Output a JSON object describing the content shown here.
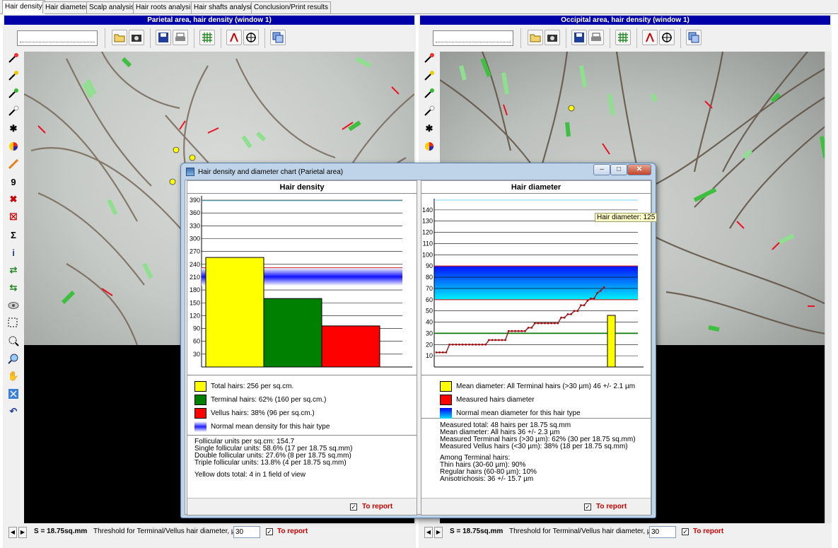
{
  "tabs": [
    {
      "label": "Hair density",
      "active": true
    },
    {
      "label": "Hair diameter"
    },
    {
      "label": "Scalp analysis"
    },
    {
      "label": "Hair roots analysis"
    },
    {
      "label": "Hair shafts analysis"
    },
    {
      "label": "Conclusion/Print results"
    }
  ],
  "left_panel": {
    "title": "Parietal area, hair density (window 1)"
  },
  "right_panel": {
    "title": "Occipital area, hair density (window 1)"
  },
  "status": {
    "area": "S = 18.75sq.mm",
    "threshold_label": "Threshold for Terminal/Vellus hair diameter, µm:",
    "threshold_value": "30",
    "to_report": "To report",
    "checked": "✓"
  },
  "dialog": {
    "title": "Hair density and diameter chart (Parietal area)",
    "buttons": {
      "minimize": "–",
      "maximize": "□",
      "close": "✕"
    }
  },
  "density": {
    "heading": "Hair density",
    "legend": [
      {
        "color": "#ffff00",
        "text": "Total hairs: 256 per sq.cm."
      },
      {
        "color": "#008000",
        "text": "Terminal hairs: 62% (160 per sq.cm.)"
      },
      {
        "color": "#ff0000",
        "text": "Vellus hairs: 38% (96 per sq.cm.)"
      },
      {
        "color": "gradient-blue",
        "text": "Normal mean density for this hair type"
      }
    ],
    "stats": [
      "Follicular units per sq.cm: 154.7",
      "Single follicular units: 58.6% (17  per 18.75 sq.mm)",
      "Double follicular units: 27.6% (8  per 18.75 sq.mm)",
      "Triple follicular units: 13.8% (4  per 18.75 sq.mm)"
    ],
    "yellow_dots": "Yellow dots total: 4 in 1 field of view",
    "to_report": "To report"
  },
  "diameter": {
    "heading": "Hair diameter",
    "tooltip": "Hair diameter: 125",
    "legend": [
      {
        "color": "#ffff00",
        "text": "Mean diameter: All Terminal hairs (>30 µm) 46 +/- 2.1 µm"
      },
      {
        "color": "#ff0000",
        "text": "Measured hairs diameter"
      },
      {
        "color": "gradient-cyan",
        "text": "Normal mean diameter for this hair type"
      }
    ],
    "stats": [
      "Measured total: 48 hairs per 18.75 sq.mm",
      "Mean diameter: All hairs 36 +/- 2.3 µm",
      "Measured Terminal hairs (>30 µm): 62% (30 per 18.75 sq.mm)",
      "Measured Vellus hairs (<30 µm): 38% (18 per 18.75 sq.mm)"
    ],
    "terminal_heading": "Among Terminal hairs:",
    "terminal_stats": [
      "Thin hairs (30-60 µm): 90%",
      "Regular hairs (60-80 µm): 10%",
      "Anisotrichosis: 36 +/- 15.7 µm"
    ],
    "to_report": "To report"
  },
  "chart_data": [
    {
      "type": "bar",
      "title": "Hair density",
      "categories": [
        "Total hairs",
        "Terminal hairs",
        "Vellus hairs"
      ],
      "values": [
        256,
        160,
        96
      ],
      "colors": [
        "#ffff00",
        "#008000",
        "#ff0000"
      ],
      "y_ticks": [
        30,
        60,
        90,
        120,
        150,
        180,
        210,
        240,
        270,
        300,
        330,
        360,
        390
      ],
      "ylim": [
        0,
        400
      ],
      "normal_band": [
        190,
        232
      ],
      "grid": true
    },
    {
      "type": "line",
      "title": "Hair diameter",
      "y_ticks": [
        10,
        20,
        30,
        40,
        50,
        60,
        70,
        80,
        90,
        100,
        110,
        120,
        130,
        140
      ],
      "ylim": [
        0,
        150
      ],
      "normal_band": [
        60,
        90
      ],
      "threshold_line": 30,
      "mean_bar": 46,
      "series": [
        {
          "values": [
            13,
            13,
            13,
            13,
            20,
            20,
            20,
            20,
            20,
            20,
            20,
            20,
            20,
            20,
            20,
            20,
            24,
            24,
            24,
            24,
            24,
            24,
            32,
            32,
            32,
            32,
            32,
            32,
            35,
            35,
            39,
            39,
            39,
            39,
            39,
            39,
            39,
            39,
            44,
            44,
            47,
            47,
            50,
            50,
            55,
            55,
            59,
            61,
            61,
            66,
            68,
            71
          ]
        }
      ],
      "grid": true
    }
  ]
}
